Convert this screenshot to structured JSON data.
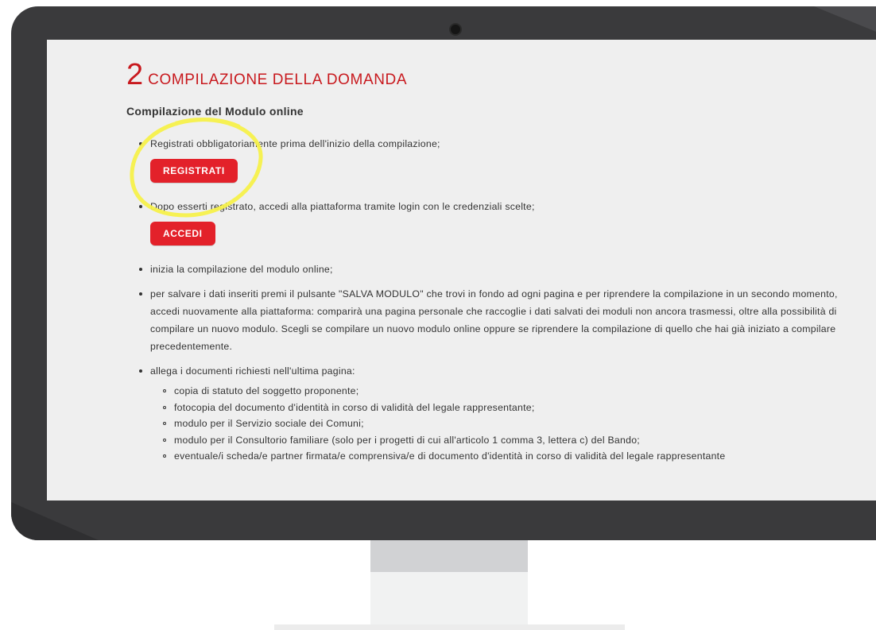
{
  "section": {
    "number": "2",
    "title": "COMPILAZIONE DELLA DOMANDA"
  },
  "subtitle": "Compilazione del Modulo online",
  "steps": {
    "register_text": "Registrati obbligatoriamente prima dell'inizio della compilazione;",
    "register_button": "REGISTRATI",
    "login_text": "Dopo esserti registrato, accedi alla piattaforma tramite login con le credenziali scelte;",
    "login_button": "ACCEDI",
    "start_text": "inizia la compilazione del modulo online;",
    "save_text": "per salvare i dati inseriti premi il pulsante \"SALVA MODULO\" che trovi in fondo ad ogni pagina e per riprendere la compilazione in un secondo momento, accedi nuovamente alla piattaforma: comparirà una pagina personale che raccoglie i dati salvati dei moduli non ancora trasmessi, oltre alla possibilità di compilare un nuovo modulo. Scegli se compilare un nuovo modulo online oppure se riprendere la compilazione di quello che hai già iniziato a compilare precedentemente.",
    "attach_text": "allega i documenti richiesti nell'ultima pagina:",
    "documents": [
      "copia di statuto del soggetto proponente;",
      "fotocopia del documento d'identità in corso di validità del legale rappresentante;",
      "modulo per il Servizio sociale dei Comuni;",
      "modulo per il Consultorio familiare (solo per i progetti di cui all'articolo 1 comma 3, lettera c) del Bando;",
      "eventuale/i scheda/e partner firmata/e comprensiva/e di documento d'identità in corso di validità del legale rappresentante"
    ]
  },
  "colors": {
    "accent": "#e3212a",
    "heading": "#c8191e",
    "highlight": "#f5f04a",
    "bezel": "#3a3a3c",
    "screen": "#efefef"
  }
}
